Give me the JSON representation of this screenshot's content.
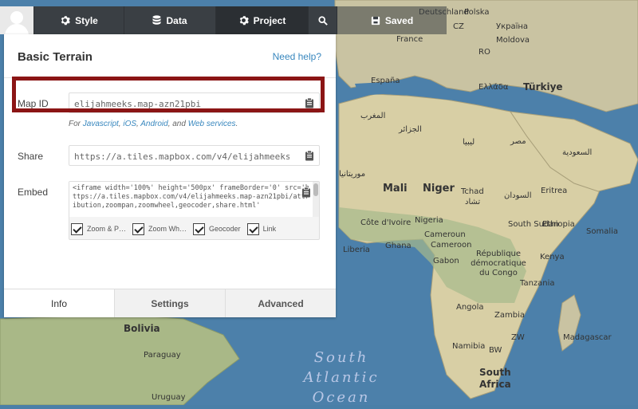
{
  "toolbar": {
    "style_label": "Style",
    "data_label": "Data",
    "project_label": "Project",
    "saved_label": "Saved"
  },
  "panel": {
    "title": "Basic Terrain",
    "help_link": "Need help?",
    "map_id": {
      "label": "Map ID",
      "value": "elijahmeeks.map-azn21pbi"
    },
    "sdk_links": {
      "prefix": "For",
      "javascript": "Javascript",
      "ios": "iOS",
      "android": "Android",
      "and": ", and",
      "web": "Web services",
      "suffix": "."
    },
    "share": {
      "label": "Share",
      "value": "https://a.tiles.mapbox.com/v4/elijahmeeks.map-azn21pbi/page.html"
    },
    "embed": {
      "label": "Embed",
      "code": "<iframe width='100%' height='500px' frameBorder='0' src='https://a.tiles.mapbox.com/v4/elijahmeeks.map-azn21pbi/attribution,zoompan,zoomwheel,geocoder,share.html'",
      "options": [
        "Zoom & P…",
        "Zoom Wh…",
        "Geocoder",
        "Link"
      ]
    },
    "tabs": [
      "Info",
      "Settings",
      "Advanced"
    ]
  },
  "map": {
    "labels": [
      {
        "text": "Deutschland",
        "cls": "small"
      },
      {
        "text": "Polska",
        "cls": "small"
      },
      {
        "text": "CZ",
        "cls": "small"
      },
      {
        "text": "France",
        "cls": "small"
      },
      {
        "text": "Україна",
        "cls": "small"
      },
      {
        "text": "Moldova",
        "cls": "small"
      },
      {
        "text": "RO",
        "cls": "small"
      },
      {
        "text": "España",
        "cls": "small"
      },
      {
        "text": "Ελλάδα",
        "cls": "small"
      },
      {
        "text": "Türkiye",
        "cls": "med"
      },
      {
        "text": "المغرب",
        "cls": "small"
      },
      {
        "text": "الجزائر",
        "cls": "small"
      },
      {
        "text": "ليبيا",
        "cls": "small"
      },
      {
        "text": "مصر",
        "cls": "small"
      },
      {
        "text": "السعودية",
        "cls": "small"
      },
      {
        "text": "موريتانيا",
        "cls": "small"
      },
      {
        "text": "Mali",
        "cls": "big"
      },
      {
        "text": "Niger",
        "cls": "big"
      },
      {
        "text": "Tchad",
        "cls": "small"
      },
      {
        "text": "تشاد",
        "cls": "small"
      },
      {
        "text": "السودان",
        "cls": "small"
      },
      {
        "text": "Eritrea",
        "cls": "small"
      },
      {
        "text": "Nigeria",
        "cls": "small"
      },
      {
        "text": "Côte d'Ivoire",
        "cls": "small"
      },
      {
        "text": "Ghana",
        "cls": "small"
      },
      {
        "text": "Liberia",
        "cls": "small"
      },
      {
        "text": "Cameroun",
        "cls": "small"
      },
      {
        "text": "Cameroon",
        "cls": "small"
      },
      {
        "text": "South Sudan",
        "cls": "small"
      },
      {
        "text": "Ethiopia",
        "cls": "small"
      },
      {
        "text": "Somalia",
        "cls": "small"
      },
      {
        "text": "Gabon",
        "cls": "small"
      },
      {
        "text": "République démocratique du Congo",
        "cls": "small"
      },
      {
        "text": "Kenya",
        "cls": "small"
      },
      {
        "text": "Tanzania",
        "cls": "small"
      },
      {
        "text": "Angola",
        "cls": "small"
      },
      {
        "text": "Zambia",
        "cls": "small"
      },
      {
        "text": "Namibia",
        "cls": "small"
      },
      {
        "text": "BW",
        "cls": "small"
      },
      {
        "text": "ZW",
        "cls": "small"
      },
      {
        "text": "Madagascar",
        "cls": "small"
      },
      {
        "text": "South Africa",
        "cls": "med"
      },
      {
        "text": "Bolivia",
        "cls": "med"
      },
      {
        "text": "Paraguay",
        "cls": "small"
      },
      {
        "text": "Uruguay",
        "cls": "small"
      },
      {
        "text": "South Atlantic Ocean",
        "cls": "ocean"
      }
    ]
  }
}
